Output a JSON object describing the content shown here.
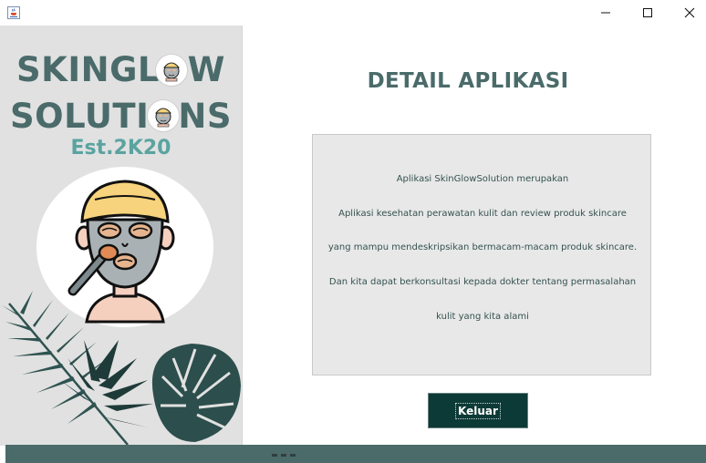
{
  "window": {
    "app_icon": "java-cup-icon",
    "controls": [
      "minimize-icon",
      "maximize-icon",
      "close-icon"
    ]
  },
  "brand": {
    "line1": "SKINGLOW",
    "line2": "SOLUTIONS",
    "est": "Est.2K20"
  },
  "detail": {
    "title": "DETAIL APLIKASI",
    "lines": [
      "Aplikasi SkinGlowSolution merupakan",
      "Aplikasi kesehatan perawatan kulit dan review produk skincare",
      "yang mampu mendeskripsikan bermacam-macam produk skincare.",
      "Dan kita dapat berkonsultasi kepada dokter tentang permasalahan",
      "kulit yang kita alami"
    ]
  },
  "actions": {
    "exit_label": "Keluar"
  },
  "colors": {
    "brand_teal": "#4a6b6a",
    "est_teal": "#5aa3a0",
    "button_bg": "#0c3a36",
    "panel_bg": "#e1e1e1"
  }
}
